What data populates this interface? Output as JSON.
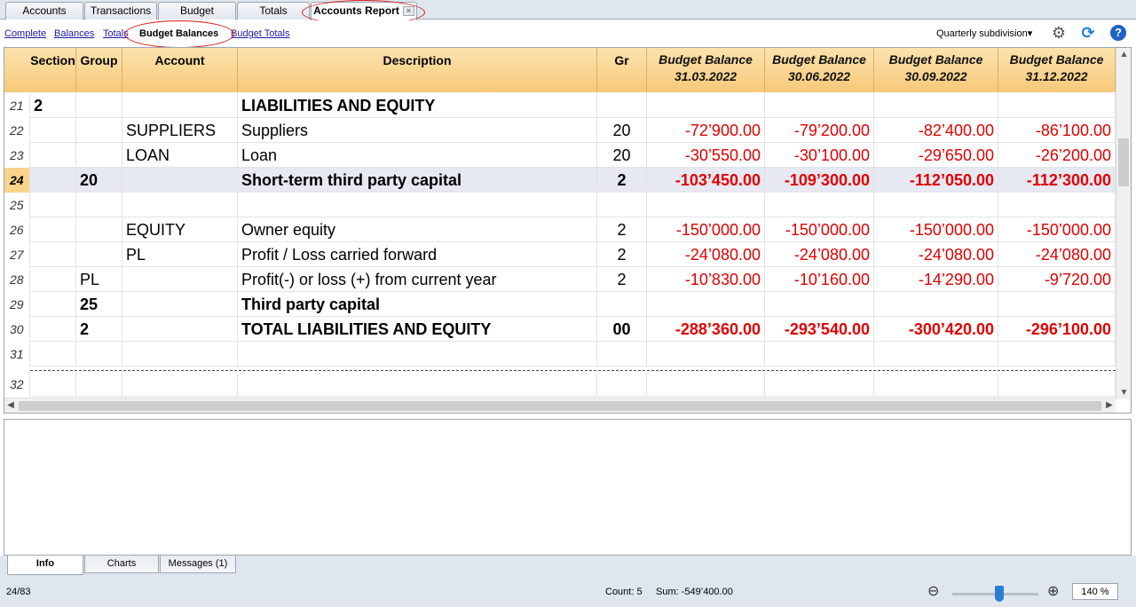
{
  "top_tabs": [
    {
      "label": "Accounts"
    },
    {
      "label": "Transactions"
    },
    {
      "label": "Budget"
    },
    {
      "label": "Totals"
    },
    {
      "label": "Accounts Report"
    }
  ],
  "sub_tabs": [
    {
      "label": "Complete"
    },
    {
      "label": "Balances"
    },
    {
      "label": "Totals"
    },
    {
      "label": "Budget Balances"
    },
    {
      "label": "Budget Totals"
    }
  ],
  "toolbar": {
    "subdivision": "Quarterly subdivision",
    "settings_icon": "gear-icon",
    "refresh_icon": "refresh-icon",
    "help_icon": "help-icon",
    "dropdown_glyph": "▾",
    "gear_glyph": "⚙",
    "refresh_glyph": "⟳",
    "help_glyph": "?"
  },
  "columns": {
    "section": "Section",
    "group": "Group",
    "account": "Account",
    "description": "Description",
    "gr": "Gr",
    "bb1": {
      "title": "Budget Balance",
      "date": "31.03.2022"
    },
    "bb2": {
      "title": "Budget Balance",
      "date": "30.06.2022"
    },
    "bb3": {
      "title": "Budget Balance",
      "date": "30.09.2022"
    },
    "bb4": {
      "title": "Budget Balance",
      "date": "31.12.2022"
    }
  },
  "rows": [
    {
      "n": "21",
      "section": "2",
      "group": "",
      "account": "",
      "description": "LIABILITIES AND EQUITY",
      "gr": "",
      "b1": "",
      "b2": "",
      "b3": "",
      "b4": ""
    },
    {
      "n": "22",
      "section": "",
      "group": "",
      "account": "SUPPLIERS",
      "description": "Suppliers",
      "gr": "20",
      "b1": "-72’900.00",
      "b2": "-79’200.00",
      "b3": "-82’400.00",
      "b4": "-86’100.00"
    },
    {
      "n": "23",
      "section": "",
      "group": "",
      "account": "LOAN",
      "description": "Loan",
      "gr": "20",
      "b1": "-30’550.00",
      "b2": "-30’100.00",
      "b3": "-29’650.00",
      "b4": "-26’200.00"
    },
    {
      "n": "24",
      "section": "",
      "group": "20",
      "account": "",
      "description": "Short-term third party capital",
      "gr": "2",
      "b1": "-103’450.00",
      "b2": "-109’300.00",
      "b3": "-112’050.00",
      "b4": "-112’300.00"
    },
    {
      "n": "25",
      "section": "",
      "group": "",
      "account": "",
      "description": "",
      "gr": "",
      "b1": "",
      "b2": "",
      "b3": "",
      "b4": ""
    },
    {
      "n": "26",
      "section": "",
      "group": "",
      "account": "EQUITY",
      "description": "Owner equity",
      "gr": "2",
      "b1": "-150’000.00",
      "b2": "-150’000.00",
      "b3": "-150’000.00",
      "b4": "-150’000.00"
    },
    {
      "n": "27",
      "section": "",
      "group": "",
      "account": "PL",
      "description": "Profit / Loss carried forward",
      "gr": "2",
      "b1": "-24’080.00",
      "b2": "-24’080.00",
      "b3": "-24’080.00",
      "b4": "-24’080.00"
    },
    {
      "n": "28",
      "section": "",
      "group": "PL",
      "account": "",
      "description": "Profit(-) or loss (+) from current year",
      "gr": "2",
      "b1": "-10’830.00",
      "b2": "-10’160.00",
      "b3": "-14’290.00",
      "b4": "-9’720.00"
    },
    {
      "n": "29",
      "section": "",
      "group": "25",
      "account": "",
      "description": "Third party capital",
      "gr": "",
      "b1": "",
      "b2": "",
      "b3": "",
      "b4": ""
    },
    {
      "n": "30",
      "section": "",
      "group": "2",
      "account": "",
      "description": "TOTAL LIABILITIES AND EQUITY",
      "gr": "00",
      "b1": "-288’360.00",
      "b2": "-293’540.00",
      "b3": "-300’420.00",
      "b4": "-296’100.00"
    },
    {
      "n": "31",
      "section": "",
      "group": "",
      "account": "",
      "description": "",
      "gr": "",
      "b1": "",
      "b2": "",
      "b3": "",
      "b4": ""
    },
    {
      "n": "32",
      "section": "",
      "group": "",
      "account": "",
      "description": "",
      "gr": "",
      "b1": "",
      "b2": "",
      "b3": "",
      "b4": ""
    }
  ],
  "bottom_tabs": [
    {
      "label": "Info"
    },
    {
      "label": "Charts"
    },
    {
      "label": "Messages (1)"
    }
  ],
  "status": {
    "position": "24/83",
    "count": "Count: 5",
    "sum": "Sum: -549’400.00",
    "zoom": "140 %",
    "zoom_level_percent": 55
  },
  "colors": {
    "negative": "#e00000",
    "header": "#f7c979",
    "selected_row": "#e6e8f2",
    "annotation": "#d71a1a"
  }
}
